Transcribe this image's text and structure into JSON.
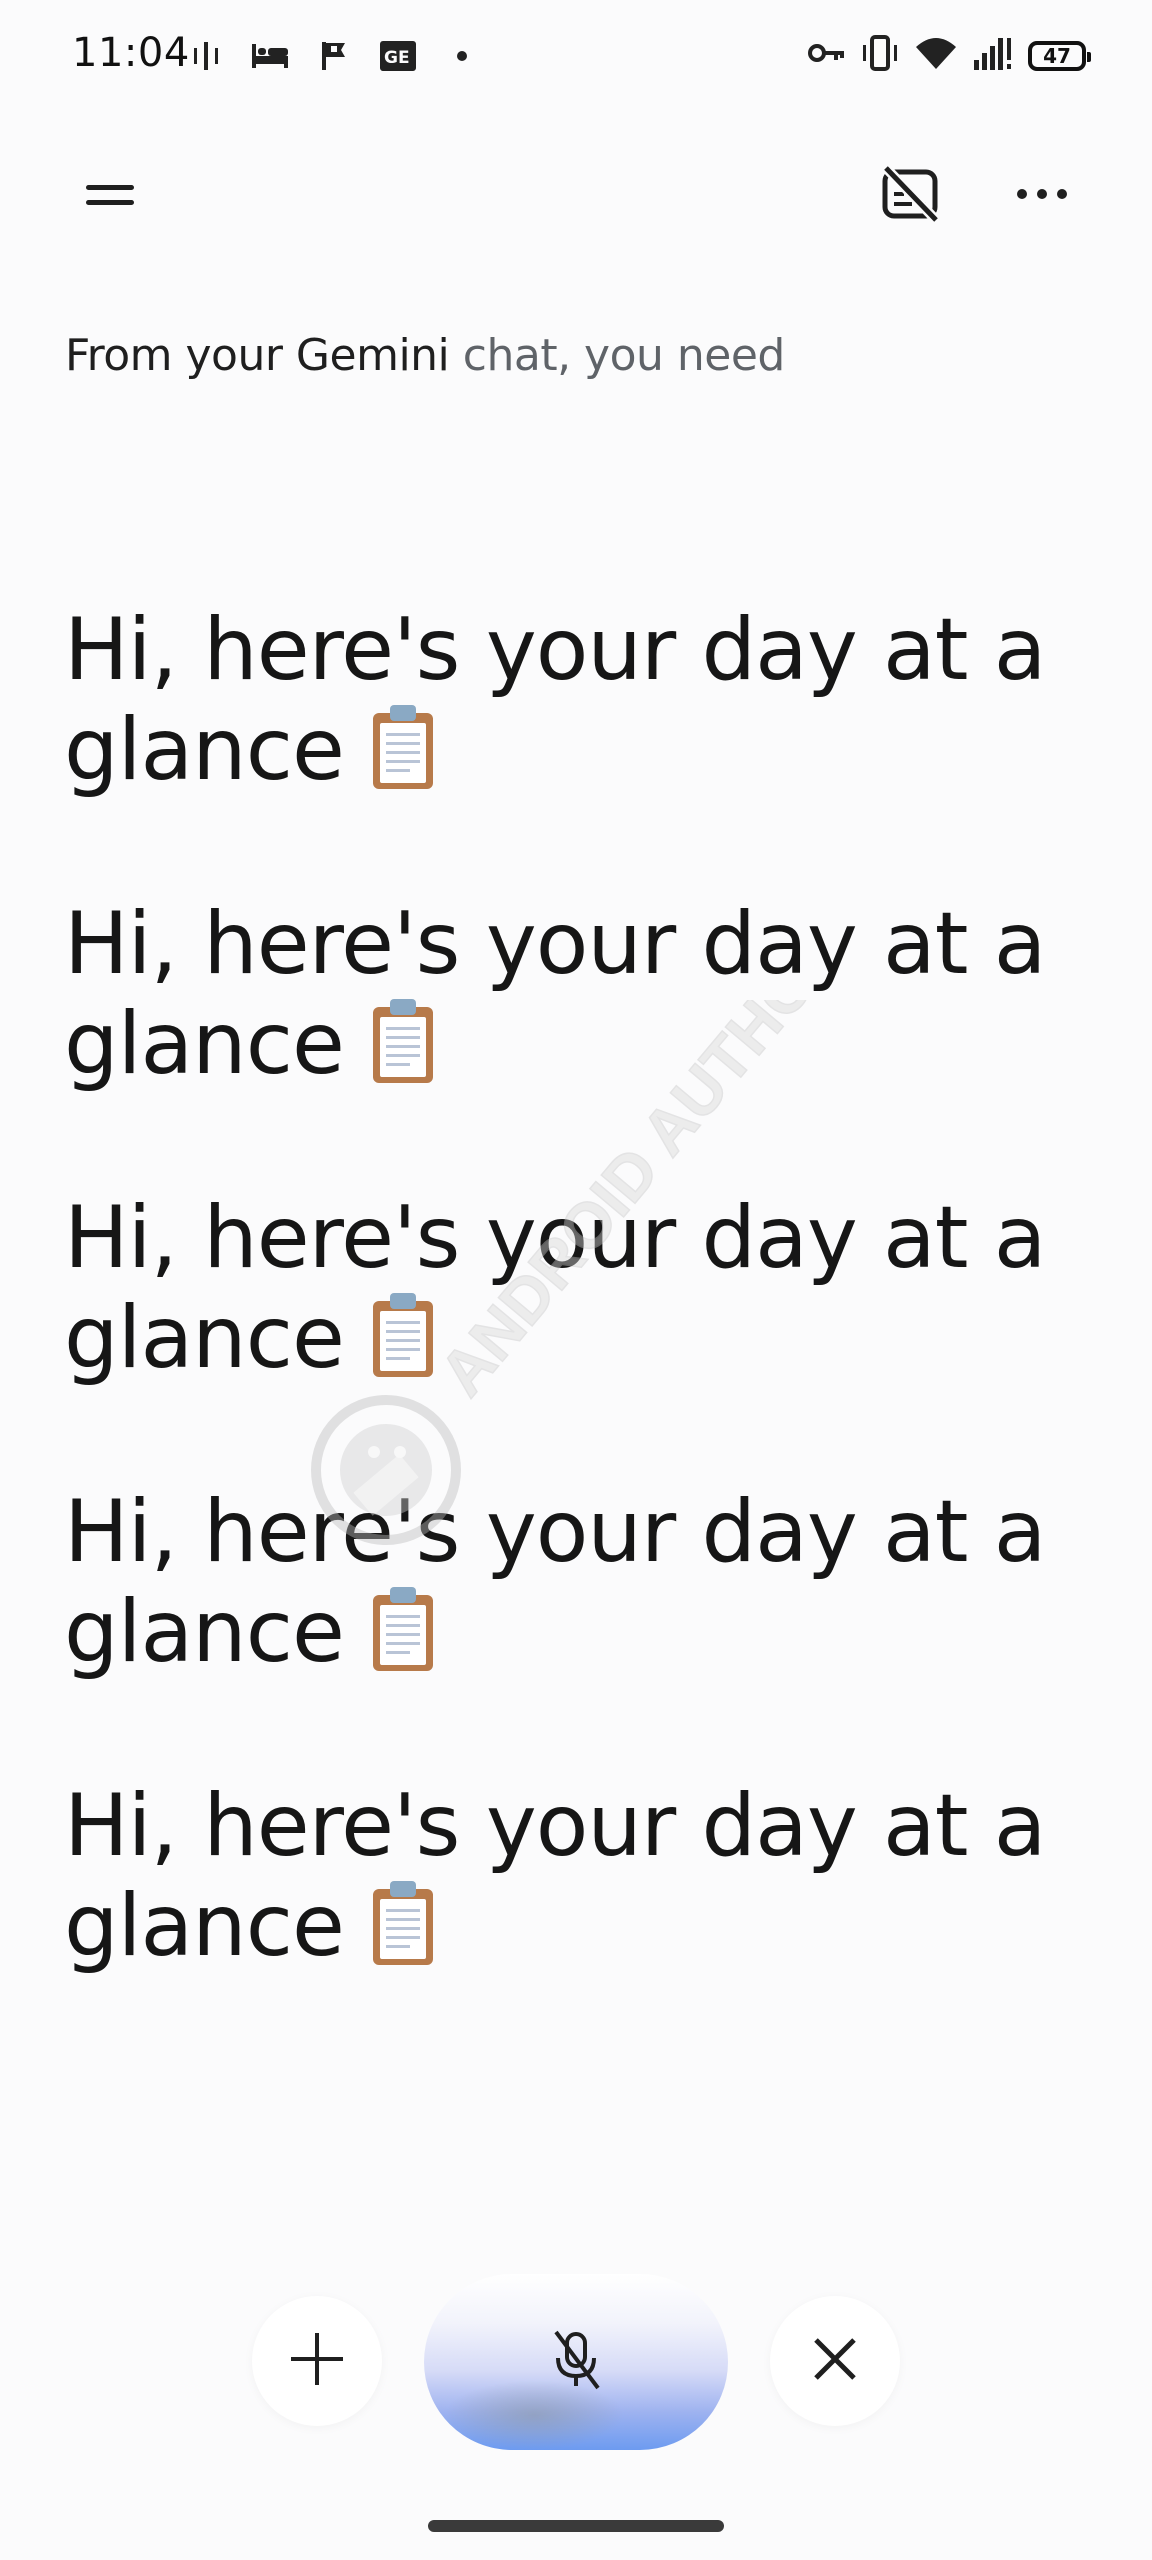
{
  "status_bar": {
    "time": "11:04",
    "battery_level": "47",
    "left_icons": [
      "activity-icon",
      "bed-icon",
      "flag-icon",
      "news-icon",
      "dot-icon"
    ],
    "right_icons": [
      "key-icon",
      "vibrate-icon",
      "wifi-icon",
      "signal-icon",
      "battery-icon"
    ]
  },
  "top_bar": {
    "menu_icon": "menu-icon",
    "caption_icon": "captions-off-icon",
    "more_icon": "more-horizontal-icon"
  },
  "context": {
    "prefix": "From your Gemini",
    "suffix": " chat, you need"
  },
  "transcript": {
    "messages": [
      {
        "line1": "Hi, here's your day at a",
        "line2": "glance"
      },
      {
        "line1": "Hi, here's your day at a",
        "line2": "glance"
      },
      {
        "line1": "Hi, here's your day at a",
        "line2": "glance"
      },
      {
        "line1": "Hi, here's your day at a",
        "line2": "glance"
      },
      {
        "line1": "Hi, here's your day at a",
        "line2": "glance"
      }
    ],
    "emoji": "clipboard-emoji"
  },
  "watermark": {
    "text": "ANDROID AUTHORITY"
  },
  "controls": {
    "add_icon": "plus-icon",
    "mic_icon": "mic-off-icon",
    "close_icon": "close-icon",
    "mic_gradient_colors": [
      "#ffffff",
      "#d6dbf7",
      "#6d9bf0"
    ]
  }
}
